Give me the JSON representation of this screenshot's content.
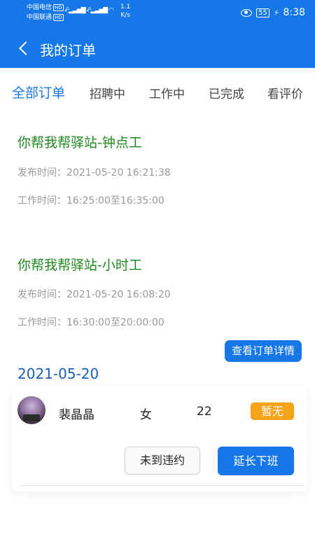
{
  "status_bar": {
    "carrier1": "中国电信",
    "carrier2": "中国联通",
    "hd": "HD",
    "net_speed_value": "1.1",
    "net_speed_unit": "K/s",
    "battery": "55",
    "time": "8:38"
  },
  "header": {
    "title": "我的订单"
  },
  "tabs": [
    {
      "label": "全部订单",
      "active": true
    },
    {
      "label": "招聘中",
      "active": false
    },
    {
      "label": "工作中",
      "active": false
    },
    {
      "label": "已完成",
      "active": false
    },
    {
      "label": "看评价",
      "active": false
    }
  ],
  "orders": [
    {
      "title": "你帮我帮驿站-钟点工",
      "publish_time": "发布时间：2021-05-20 16:21:38",
      "work_time": "工作时间：16:25:00至16:35:00"
    },
    {
      "title": "你帮我帮驿站-小时工",
      "publish_time": "发布时间：2021-05-20 16:08:20",
      "work_time": "工作时间：16:30:00至20:00:00",
      "detail_button": "查看订单详情",
      "date": "2021-05-20",
      "worker": {
        "name": "裴晶晶",
        "gender": "女",
        "age": "22",
        "status": "暂无"
      },
      "actions": {
        "no_show": "未到违约",
        "extend": "延长下班"
      }
    }
  ],
  "colors": {
    "primary": "#1677e8",
    "order_title": "#1f8a1f",
    "badge": "#f7a21b",
    "meta": "#999999"
  }
}
